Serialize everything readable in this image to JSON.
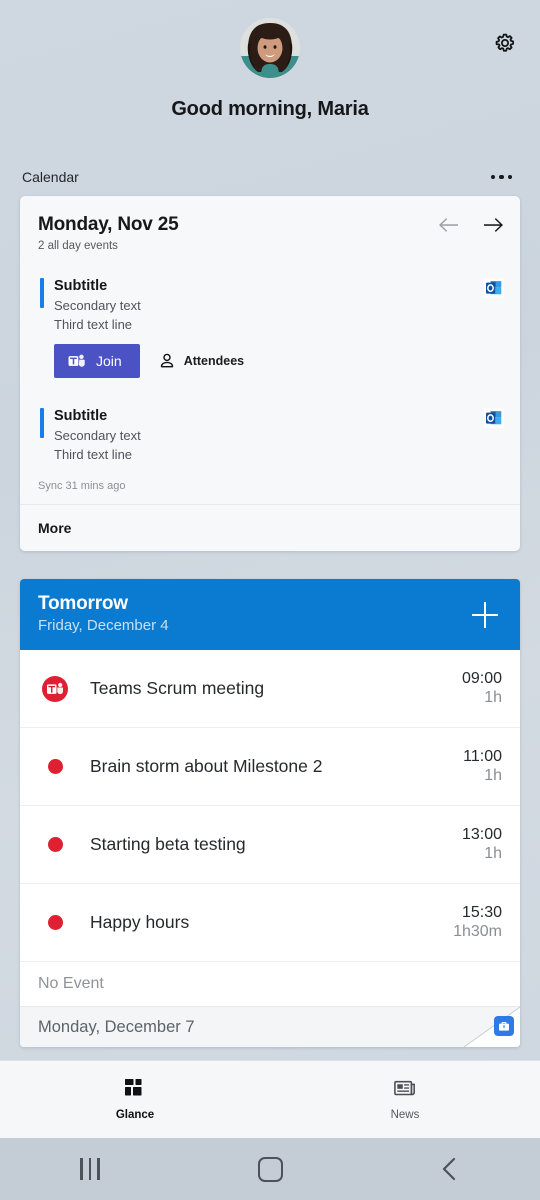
{
  "header": {
    "greeting": "Good morning, Maria",
    "avatar_icon": "user-avatar-photo",
    "settings_icon": "gear-icon"
  },
  "calendar_section": {
    "label": "Calendar",
    "overflow_icon": "ellipsis-icon"
  },
  "calendar_card": {
    "date": "Monday, Nov 25",
    "summary": "2 all day events",
    "prev_icon": "arrow-left-icon",
    "next_icon": "arrow-right-icon",
    "events": [
      {
        "title": "Subtitle",
        "secondary": "Secondary text",
        "third": "Third text line",
        "source_icon": "outlook-icon",
        "join_label": "Join",
        "join_icon": "teams-icon",
        "attendees_label": "Attendees",
        "attendees_icon": "person-icon"
      },
      {
        "title": "Subtitle",
        "secondary": "Secondary text",
        "third": "Third text line",
        "source_icon": "outlook-icon"
      }
    ],
    "sync_status": "Sync 31 mins ago",
    "more_label": "More"
  },
  "tomorrow_card": {
    "title": "Tomorrow",
    "subtitle": "Friday, December 4",
    "add_icon": "plus-icon",
    "header_color": "#0a7bd0",
    "events": [
      {
        "name": "Teams Scrum meeting",
        "time": "09:00",
        "duration": "1h",
        "icon": "teams-circle-icon",
        "marker": "teams"
      },
      {
        "name": "Brain storm about Milestone 2",
        "time": "11:00",
        "duration": "1h",
        "icon": "red-dot-icon",
        "marker": "dot"
      },
      {
        "name": "Starting beta testing",
        "time": "13:00",
        "duration": "1h",
        "icon": "red-dot-icon",
        "marker": "dot"
      },
      {
        "name": "Happy hours",
        "time": "15:30",
        "duration": "1h30m",
        "icon": "red-dot-icon",
        "marker": "dot"
      }
    ],
    "no_event_label": "No Event",
    "next_day_label": "Monday, December 7",
    "work_badge_icon": "briefcase-icon"
  },
  "bottom_nav": {
    "tabs": [
      {
        "label": "Glance",
        "icon": "grid-icon",
        "active": true
      },
      {
        "label": "News",
        "icon": "newspaper-icon",
        "active": false
      }
    ]
  },
  "system_nav": {
    "recents_icon": "recents-icon",
    "home_icon": "home-icon",
    "back_icon": "back-icon"
  },
  "colors": {
    "accent_blue": "#1b7ceb",
    "header_blue": "#0a7bd0",
    "teams_purple": "#4b53c4",
    "event_red": "#dd2132"
  }
}
